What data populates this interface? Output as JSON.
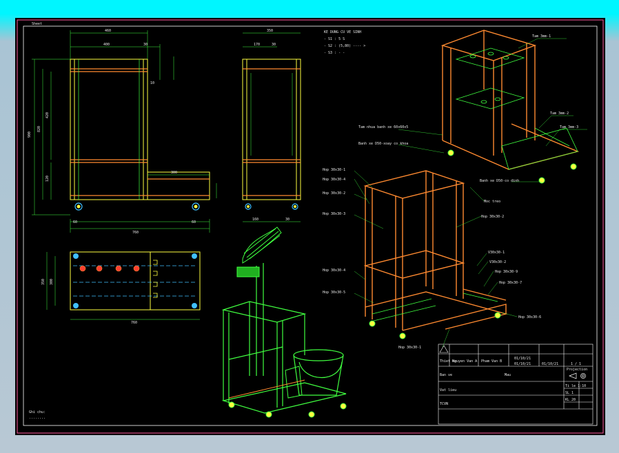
{
  "sheet": {
    "corner_label": "Sheet",
    "bottom_note_1": "Ghi chu:",
    "bottom_note_2": "........"
  },
  "front_view": {
    "dim_total_width": "460",
    "dim_inner_width": "400",
    "dim_edge": "30",
    "dim_side_small": "10",
    "dim_height_total": "900",
    "dim_height_upper": "820",
    "dim_height_mid": "420",
    "dim_height_low": "120",
    "dim_ext_width": "300",
    "dim_foot_left": "60",
    "dim_foot_right": "60",
    "dim_bottom_total": "760"
  },
  "side_view": {
    "dim_width": "350",
    "dim_inner": "170",
    "dim_small": "30",
    "dim_bottom_left": "160",
    "dim_bottom_right": "30"
  },
  "top_view": {
    "dim_depth": "350",
    "dim_inner": "300",
    "dim_length": "760"
  },
  "notes": {
    "title": "KE DUNG CU VE SINH",
    "line1": "- S1 : 5 S",
    "line2": "- S2 : (5,80) ---- >",
    "line3": "- S3 : - -"
  },
  "labels_iso_top": [
    "Tam 3mm-1",
    "Tam 3mm-2",
    "Tam 3mm-3",
    "Tam nhua banh xe 60x60x5",
    "Banh xe D50-xoay co khoa",
    "Banh xe D50-co dinh"
  ],
  "labels_iso_frame_left": [
    "Hop 30x30-1",
    "Hop 30x30-4",
    "Hop 30x30-2",
    "Hop 30x30-3",
    "Hop 30x30-4",
    "Hop 30x30-5",
    "Hop 30x30-1"
  ],
  "labels_iso_frame_right": [
    "Moc treo",
    "Hop 30x30-2",
    "V30x30-1",
    "V30x30-2",
    "Hop 30x30-9",
    "Hop 30x30-7",
    "Hop 30x30-6"
  ],
  "title_block": {
    "row1": [
      "",
      "",
      "",
      ""
    ],
    "designer_label": "Thiet ke",
    "designer_name": "Nguyen Van A",
    "checker_name": "Pham Van B",
    "date1": "01/10/21",
    "date2": "01/10/21",
    "date3": "01/10/21",
    "sheet_no": "1 / 1",
    "projection": "Projection",
    "title": "Ban ve",
    "part": "Mau",
    "material": "Vat lieu",
    "scale": "Ti le 1:10",
    "qty": "SL 1",
    "weight": "KL 20",
    "standard": "TCVN"
  }
}
